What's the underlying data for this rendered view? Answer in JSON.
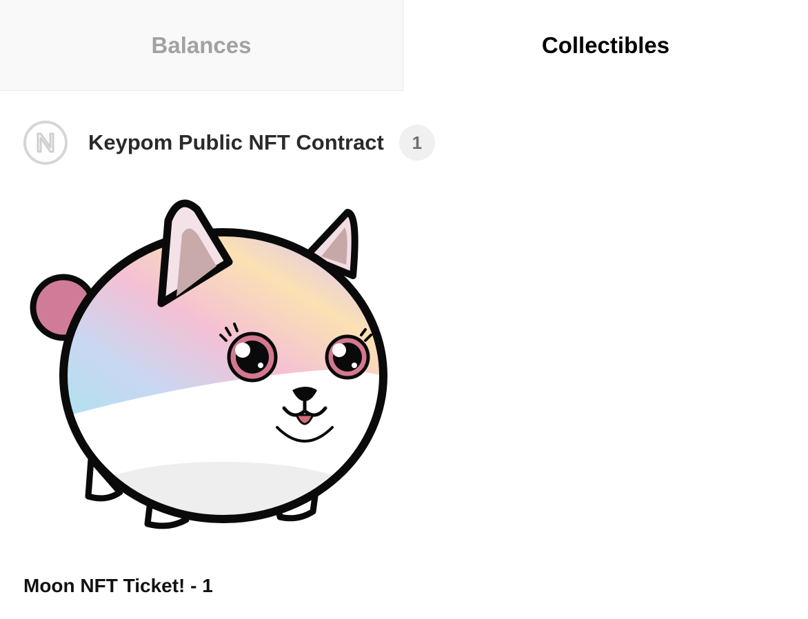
{
  "tabs": [
    {
      "label": "Balances",
      "active": false
    },
    {
      "label": "Collectibles",
      "active": true
    }
  ],
  "collection": {
    "name": "Keypom Public NFT Contract",
    "count": "1",
    "icon": "near-logo-icon"
  },
  "nft": {
    "title": "Moon NFT Ticket! - 1",
    "image": "white-hamster-dog-nft-image"
  },
  "colors": {
    "tab_inactive_bg": "#f9f9f9",
    "tab_inactive_text": "#a1a1a6",
    "tab_active_text": "#000000",
    "badge_bg": "#f0f0f1",
    "ear_pink": "#d9829b"
  }
}
